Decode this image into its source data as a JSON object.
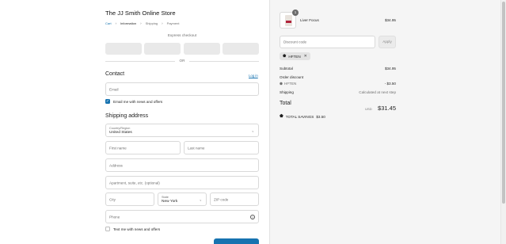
{
  "store": {
    "title": "The JJ Smith Online Store"
  },
  "breadcrumb": {
    "items": [
      "Cart",
      "Information",
      "Shipping",
      "Payment"
    ]
  },
  "express": {
    "label": "Express checkout",
    "or": "OR"
  },
  "contact": {
    "title": "Contact",
    "login": "Log in",
    "email_placeholder": "Email",
    "news_label": "Email me with news and offers",
    "news_checked": true
  },
  "shipping": {
    "title": "Shipping address",
    "country_label": "Country/Region",
    "country_value": "United States",
    "first_name": "First name",
    "last_name": "Last name",
    "address": "Address",
    "apartment": "Apartment, suite, etc. (optional)",
    "city": "City",
    "state_label": "State",
    "state_value": "New York",
    "zip": "ZIP code",
    "phone": "Phone",
    "text_label": "Text me with news and offers",
    "text_checked": false
  },
  "order": {
    "product": {
      "name": "Liver Focus",
      "price": "$34.95",
      "quantity": "1"
    },
    "discount_placeholder": "Discount code",
    "apply": "Apply",
    "applied_code": "HFTEN",
    "subtotal_label": "Subtotal",
    "subtotal": "$34.95",
    "order_discount_label": "Order discount",
    "discount_code": "HFTEN",
    "discount_amount": "- $3.50",
    "shipping_label": "Shipping",
    "shipping_value": "Calculated at next step",
    "total_label": "Total",
    "currency": "USD",
    "total": "$31.45",
    "savings_label": "TOTAL SAVINGS",
    "savings_amount": "$3.50"
  },
  "colors": {
    "accent": "#1773b0",
    "sidebar_bg": "#f5f5f5"
  },
  "icons": [
    "chevron-right-icon",
    "chevron-down-icon",
    "tag-icon",
    "close-icon",
    "help-icon",
    "checkmark-icon"
  ]
}
